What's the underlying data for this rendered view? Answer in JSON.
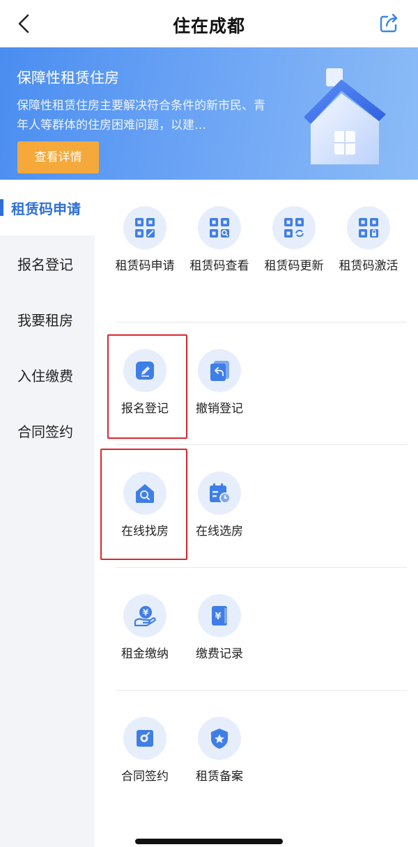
{
  "nav": {
    "title": "住在成都",
    "back_icon": "chevron-left-icon",
    "share_icon": "share-icon"
  },
  "banner": {
    "title": "保障性租赁住房",
    "description": "保障性租赁住房主要解决符合条件的新市民、青年人等群体的住房困难问题，以建…",
    "button_label": "查看详情",
    "colors": {
      "background": "#5a97f2",
      "button": "#f4a93a"
    }
  },
  "sidebar": {
    "items": [
      {
        "label": "租赁码申请",
        "active": true
      },
      {
        "label": "报名登记",
        "active": false
      },
      {
        "label": "我要租房",
        "active": false
      },
      {
        "label": "入住缴费",
        "active": false
      },
      {
        "label": "合同签约",
        "active": false
      }
    ],
    "accent": "#2f6fd8"
  },
  "sections": [
    {
      "tiles": [
        {
          "label": "租赁码申请",
          "icon": "qr-edit-icon"
        },
        {
          "label": "租赁码查看",
          "icon": "qr-search-icon"
        },
        {
          "label": "租赁码更新",
          "icon": "qr-refresh-icon"
        },
        {
          "label": "租赁码激活",
          "icon": "qr-lock-icon"
        }
      ]
    },
    {
      "tiles": [
        {
          "label": "报名登记",
          "icon": "edit-icon"
        },
        {
          "label": "撤销登记",
          "icon": "undo-icon"
        }
      ]
    },
    {
      "tiles": [
        {
          "label": "在线找房",
          "icon": "house-search-icon"
        },
        {
          "label": "在线选房",
          "icon": "calendar-clock-icon"
        }
      ]
    },
    {
      "tiles": [
        {
          "label": "租金缴纳",
          "icon": "hand-yuan-icon"
        },
        {
          "label": "缴费记录",
          "icon": "yuan-book-icon"
        }
      ]
    },
    {
      "tiles": [
        {
          "label": "合同签约",
          "icon": "contract-sign-icon"
        },
        {
          "label": "租赁备案",
          "icon": "badge-star-icon"
        }
      ]
    }
  ],
  "highlight_color": "#e0242b"
}
